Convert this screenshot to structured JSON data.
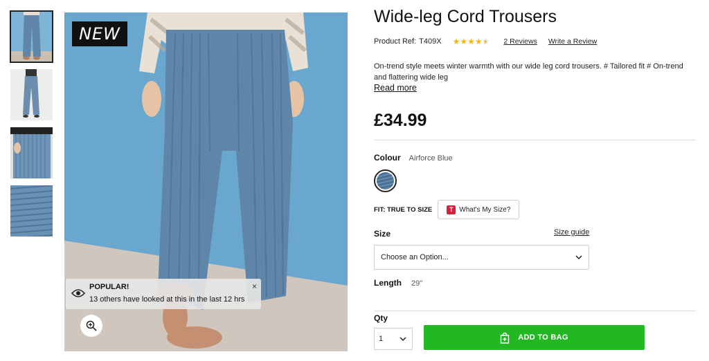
{
  "product": {
    "title": "Wide-leg Cord Trousers",
    "ref_label": "Product Ref:",
    "ref_value": "T409X",
    "rating": 4.5,
    "reviews_link": "2 Reviews",
    "write_review": "Write a Review",
    "description": "On-trend style meets winter warmth with our wide leg cord trousers. # Tailored fit # On-trend and flattering wide leg",
    "read_more": "Read more",
    "price": "£34.99"
  },
  "colour": {
    "label": "Colour",
    "value": "Airforce Blue",
    "swatch_color": "#5f86a9"
  },
  "fit": {
    "label": "FIT: TRUE TO SIZE",
    "button_logo": "T",
    "button_label": "What's My Size?"
  },
  "size": {
    "label": "Size",
    "guide_link": "Size guide",
    "placeholder": "Choose an Option..."
  },
  "length": {
    "label": "Length",
    "value": "29\""
  },
  "qty": {
    "label": "Qty",
    "value": "1"
  },
  "add_to_bag": {
    "label": "ADD TO BAG",
    "color": "#21b823"
  },
  "image": {
    "badge": "NEW",
    "popular_title": "POPULAR!",
    "popular_text": "13 others have looked at this in the last 12 hrs",
    "popular_close": "×"
  },
  "thumbnails": [
    {
      "name": "front-view",
      "active": true
    },
    {
      "name": "full-length-view",
      "active": false
    },
    {
      "name": "pocket-detail",
      "active": false
    },
    {
      "name": "fabric-closeup",
      "active": false
    }
  ],
  "colors": {
    "trouser": "#5f86a9",
    "wall": "#6aa7cf",
    "floor": "#cfc7bd"
  }
}
